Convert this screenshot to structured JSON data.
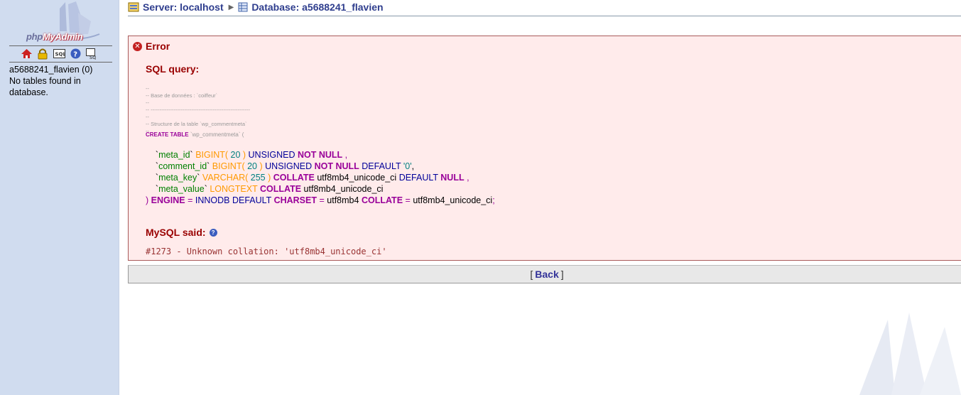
{
  "left": {
    "logo": {
      "php": "php",
      "admin": "MyAdmin"
    },
    "nav_icons": [
      {
        "name": "home-icon",
        "glyph": "⌂"
      },
      {
        "name": "lock-icon",
        "glyph": "🔒"
      },
      {
        "name": "sql-icon",
        "glyph": "SQL"
      },
      {
        "name": "help-icon",
        "glyph": "?"
      },
      {
        "name": "query-window-icon",
        "glyph": "sq"
      }
    ],
    "db_line": "a5688241_flavien (0)",
    "no_tables": "No tables found in database."
  },
  "breadcrumb": {
    "server": "Server: localhost",
    "database": "Database: a5688241_flavien"
  },
  "error": {
    "title": "Error",
    "sql_heading": "SQL query:",
    "comment_lines": "--\n-- Base de données : `coiffeur`\n--\n-- --------------------------------------------------------\n--\n-- Structure de la table `wp_commentmeta`\n--",
    "create_kw": "CREATE TABLE",
    "create_rest": " `wp_commentmeta` (",
    "mysql_said": "MySQL said:",
    "error_code": "#1273 - Unknown collation: 'utf8mb4_unicode_ci'"
  },
  "sql": {
    "l1": {
      "id": "meta_id",
      "fn": "BIGINT",
      "num": "20",
      "unsigned": "UNSIGNED",
      "notnull": "NOT NULL"
    },
    "l2": {
      "id": "comment_id",
      "fn": "BIGINT",
      "num": "20",
      "unsigned": "UNSIGNED",
      "notnull": "NOT NULL",
      "default": "DEFAULT",
      "defval": "'0'"
    },
    "l3": {
      "id": "meta_key",
      "fn": "VARCHAR",
      "num": "255",
      "collate": "COLLATE",
      "coll": "utf8mb4_unicode_ci",
      "default": "DEFAULT",
      "null": "NULL"
    },
    "l4": {
      "id": "meta_value",
      "fn": "LONGTEXT",
      "collate": "COLLATE",
      "coll": "utf8mb4_unicode_ci"
    },
    "l5": {
      "engine": "ENGINE",
      "innodb": "INNODB",
      "default": "DEFAULT",
      "charset": "CHARSET",
      "cs": "utf8mb4",
      "collate": "COLLATE",
      "coll": "utf8mb4_unicode_ci"
    }
  },
  "back": {
    "label": "Back",
    "open": "[",
    "close": "]"
  },
  "colors": {
    "error_red": "#990000",
    "box_bg": "#ffebeb",
    "left_bg": "#d0dcef",
    "link": "#333399"
  }
}
